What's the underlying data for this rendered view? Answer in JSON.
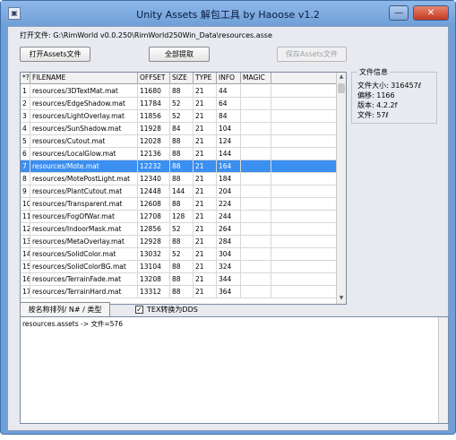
{
  "window": {
    "title": "Unity Assets 解包工具 by Haoose v1.2",
    "min_label": "—",
    "close_label": "✕"
  },
  "open_path": "打开文件: G:\\RimWorld v0.0.250\\RimWorld250Win_Data\\resources.asse",
  "buttons": {
    "open_assets": "打开Assets文件",
    "extract_all": "全部提取",
    "save_assets": "保存Assets文件"
  },
  "table": {
    "headers": [
      "*?",
      "FILENAME",
      "OFFSET",
      "SIZE",
      "TYPE",
      "INFO",
      "MAGIC"
    ],
    "selected_row": 6,
    "rows": [
      [
        "1",
        "resources/3DTextMat.mat",
        "11680",
        "88",
        "21",
        "44",
        ""
      ],
      [
        "2",
        "resources/EdgeShadow.mat",
        "11784",
        "52",
        "21",
        "64",
        ""
      ],
      [
        "3",
        "resources/LightOverlay.mat",
        "11856",
        "52",
        "21",
        "84",
        ""
      ],
      [
        "4",
        "resources/SunShadow.mat",
        "11928",
        "84",
        "21",
        "104",
        ""
      ],
      [
        "5",
        "resources/Cutout.mat",
        "12028",
        "88",
        "21",
        "124",
        ""
      ],
      [
        "6",
        "resources/LocalGlow.mat",
        "12136",
        "88",
        "21",
        "144",
        ""
      ],
      [
        "7",
        "resources/Mote.mat",
        "12232",
        "88",
        "21",
        "164",
        ""
      ],
      [
        "8",
        "resources/MotePostLight.mat",
        "12340",
        "88",
        "21",
        "184",
        ""
      ],
      [
        "9",
        "resources/PlantCutout.mat",
        "12448",
        "144",
        "21",
        "204",
        ""
      ],
      [
        "10",
        "resources/Transparent.mat",
        "12608",
        "88",
        "21",
        "224",
        ""
      ],
      [
        "11",
        "resources/FogOfWar.mat",
        "12708",
        "128",
        "21",
        "244",
        ""
      ],
      [
        "12",
        "resources/IndoorMask.mat",
        "12856",
        "52",
        "21",
        "264",
        ""
      ],
      [
        "13",
        "resources/MetaOverlay.mat",
        "12928",
        "88",
        "21",
        "284",
        ""
      ],
      [
        "14",
        "resources/SolidColor.mat",
        "13032",
        "52",
        "21",
        "304",
        ""
      ],
      [
        "15",
        "resources/SolidColorBG.mat",
        "13104",
        "88",
        "21",
        "324",
        ""
      ],
      [
        "16",
        "resources/TerrainFade.mat",
        "13208",
        "88",
        "21",
        "344",
        ""
      ],
      [
        "17",
        "resources/TerrainHard.mat",
        "13312",
        "88",
        "21",
        "364",
        ""
      ]
    ]
  },
  "file_info": {
    "legend": "文件信息",
    "size": "文件大小: 316457ℓ",
    "offset": "偏移: 1166",
    "version": "版本: 4.2.2f",
    "count": "文件: 57ℓ"
  },
  "sort_button": "按名称排列/ N# / 类型",
  "dds_checkbox": {
    "checked": true,
    "mark": "✓",
    "label": "TEX转换为DDS"
  },
  "log": "resources.assets -> 文件=576"
}
